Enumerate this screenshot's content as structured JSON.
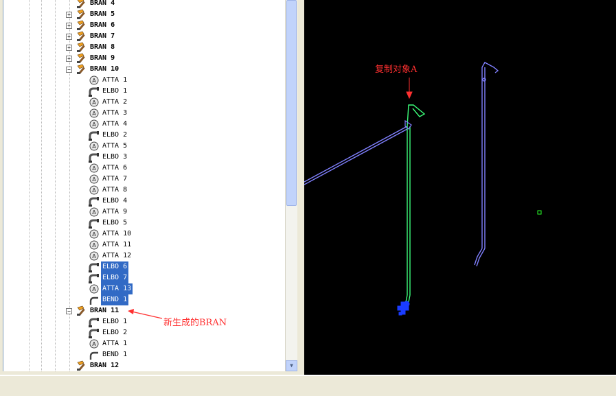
{
  "tree": {
    "nodes": [
      {
        "label": "BRAN 4",
        "kind": "bran"
      },
      {
        "label": "BRAN 5",
        "kind": "bran",
        "expander": "+"
      },
      {
        "label": "BRAN 6",
        "kind": "bran",
        "expander": "+"
      },
      {
        "label": "BRAN 7",
        "kind": "bran",
        "expander": "+"
      },
      {
        "label": "BRAN 8",
        "kind": "bran",
        "expander": "+"
      },
      {
        "label": "BRAN 9",
        "kind": "bran",
        "expander": "+"
      },
      {
        "label": "BRAN 10",
        "kind": "bran",
        "expander": "−"
      },
      {
        "label": "ATTA 1",
        "kind": "atta"
      },
      {
        "label": "ELBO 1",
        "kind": "elbo"
      },
      {
        "label": "ATTA 2",
        "kind": "atta"
      },
      {
        "label": "ATTA 3",
        "kind": "atta"
      },
      {
        "label": "ATTA 4",
        "kind": "atta"
      },
      {
        "label": "ELBO 2",
        "kind": "elbo"
      },
      {
        "label": "ATTA 5",
        "kind": "atta"
      },
      {
        "label": "ELBO 3",
        "kind": "elbo"
      },
      {
        "label": "ATTA 6",
        "kind": "atta"
      },
      {
        "label": "ATTA 7",
        "kind": "atta"
      },
      {
        "label": "ATTA 8",
        "kind": "atta"
      },
      {
        "label": "ELBO 4",
        "kind": "elbo"
      },
      {
        "label": "ATTA 9",
        "kind": "atta"
      },
      {
        "label": "ELBO 5",
        "kind": "elbo"
      },
      {
        "label": "ATTA 10",
        "kind": "atta"
      },
      {
        "label": "ATTA 11",
        "kind": "atta"
      },
      {
        "label": "ATTA 12",
        "kind": "atta"
      },
      {
        "label": "ELBO 6",
        "kind": "elbo",
        "selected": true
      },
      {
        "label": "ELBO 7",
        "kind": "elbo",
        "selected": true
      },
      {
        "label": "ATTA 13",
        "kind": "atta",
        "selected": true
      },
      {
        "label": "BEND 1",
        "kind": "bend",
        "selected": true
      },
      {
        "label": "BRAN 11",
        "kind": "bran",
        "expander": "−"
      },
      {
        "label": "ELBO 1",
        "kind": "elbo"
      },
      {
        "label": "ELBO 2",
        "kind": "elbo"
      },
      {
        "label": "ATTA 1",
        "kind": "atta"
      },
      {
        "label": "BEND 1",
        "kind": "bend"
      },
      {
        "label": "BRAN 12",
        "kind": "bran"
      }
    ]
  },
  "annotations": {
    "copy_object": "复制对象A",
    "new_bran": "新生成的BRAN"
  },
  "colors": {
    "selection": "#316ac5",
    "annotation": "#ff3030",
    "pipe_copy": "#3cff7a",
    "pipe_original": "#8080ff",
    "pipe_component": "#1a3cff",
    "marker": "#2aff2a"
  },
  "icons": {
    "bran": "hammer-icon",
    "atta": "attachment-icon",
    "elbo": "elbow-icon",
    "bend": "bend-icon"
  }
}
